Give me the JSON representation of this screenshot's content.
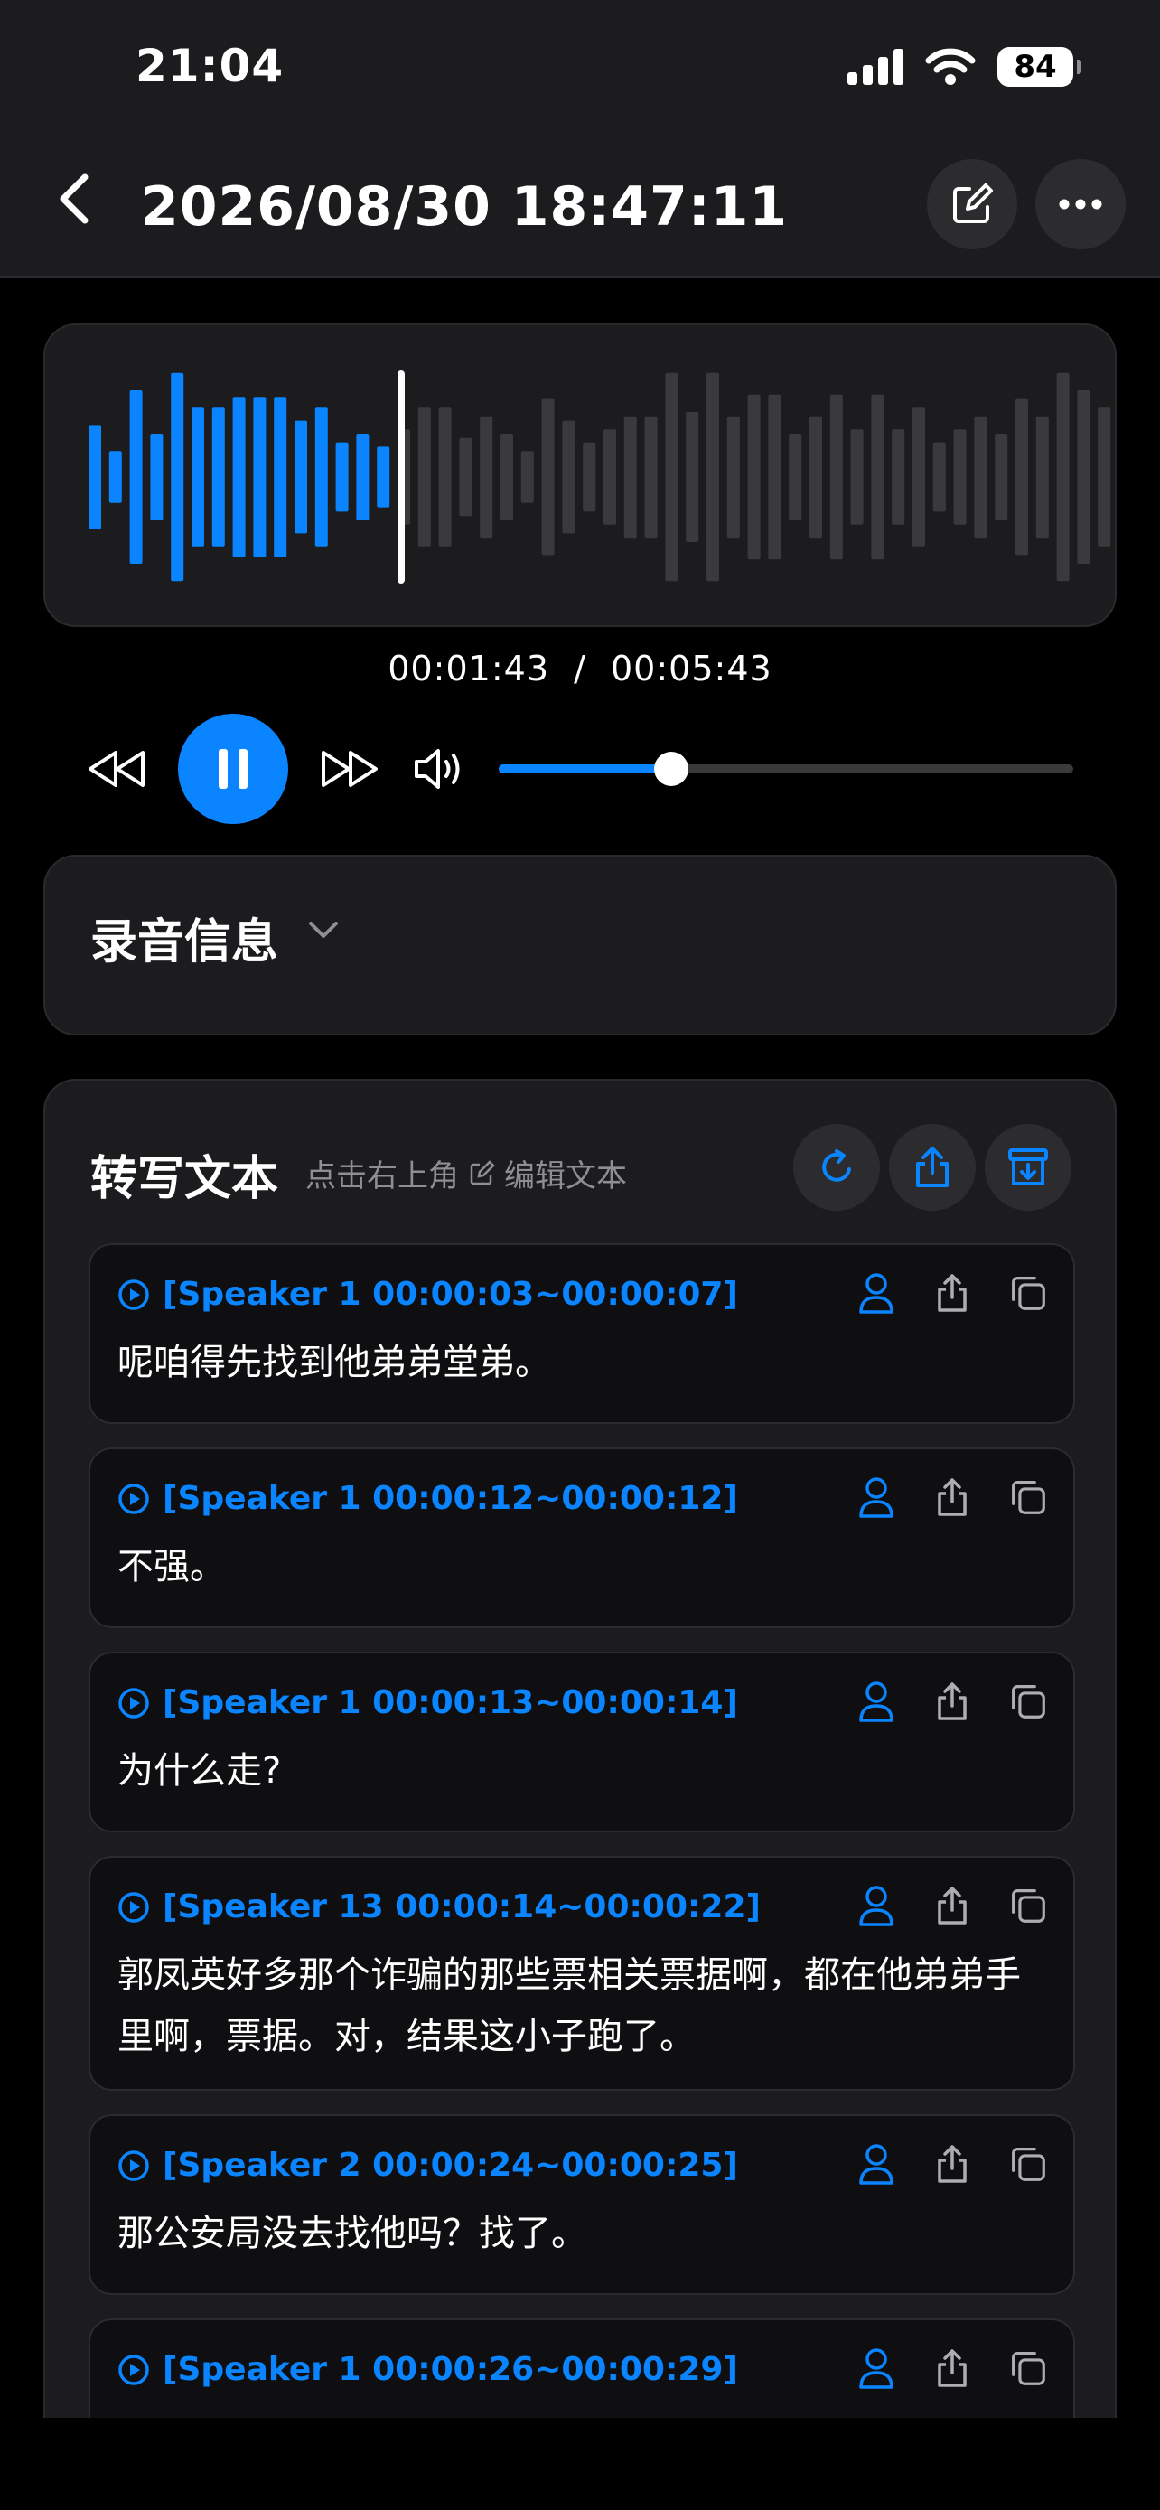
{
  "status_bar": {
    "time": "21:04",
    "battery": "84"
  },
  "header": {
    "title": "2026/08/30 18:47:11"
  },
  "player": {
    "current_time": "00:01:43",
    "separator": "/",
    "total_time": "00:05:43",
    "progress": 0.3
  },
  "waveform": {
    "played_color": "#0a84ff",
    "unplayed_color": "#3a3a3c",
    "playhead_fraction": 0.3
  },
  "recording_info": {
    "title": "录音信息"
  },
  "transcript": {
    "title": "转写文本",
    "hint_prefix": "点击右上角",
    "hint_suffix": "编辑文本",
    "segments": [
      {
        "label": "[Speaker 1 00:00:03~00:00:07]",
        "text": "呢咱得先找到他弟弟堂弟。"
      },
      {
        "label": "[Speaker 1 00:00:12~00:00:12]",
        "text": "不强。"
      },
      {
        "label": "[Speaker 1 00:00:13~00:00:14]",
        "text": "为什么走?"
      },
      {
        "label": "[Speaker 13 00:00:14~00:00:22]",
        "text": "郭凤英好多那个诈骗的那些票相关票据啊，都在他弟弟手里啊，票据。对，结果这小子跑了。"
      },
      {
        "label": "[Speaker 2 00:00:24~00:00:25]",
        "text": "那公安局没去找他吗？找了。"
      },
      {
        "label": "[Speaker 1 00:00:26~00:00:29]",
        "text": ""
      }
    ]
  },
  "colors": {
    "accent": "#0a84ff",
    "card": "#1c1c1e",
    "background": "#000000"
  }
}
